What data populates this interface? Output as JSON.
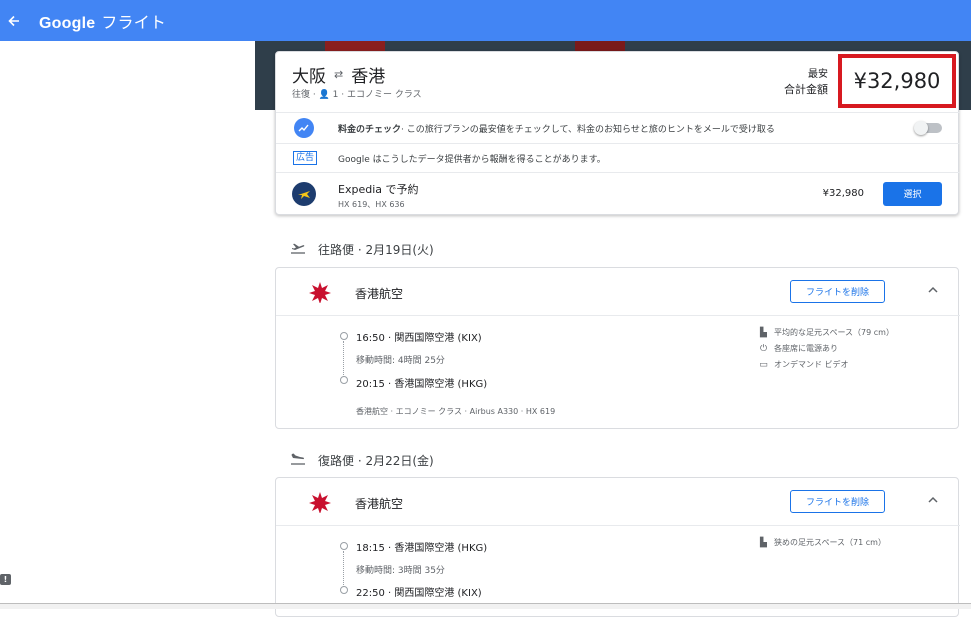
{
  "header": {
    "back_icon": "arrow-left-icon",
    "brand_google": "Google",
    "brand_flights": "フライト",
    "color": "#4285f4"
  },
  "summary": {
    "from": "大阪",
    "to": "香港",
    "swap_icon": "swap-arrows-icon",
    "trip_info": "往復 · 👤 1 · エコノミー クラス",
    "price_label_line1": "最安",
    "price_label_line2": "合計金額",
    "price": "¥32,980",
    "highlight_color": "#d71920",
    "price_tracking_title": "料金のチェック",
    "price_tracking_text": "· この旅行プランの最安値をチェックして、料金のお知らせと旅のヒントをメールで受け取る",
    "price_tracking_on": false,
    "ad_tag": "広告",
    "ad_text": "Google はこうしたデータ提供者から報酬を得ることがあります。",
    "provider_title": "Expedia で予約",
    "provider_flights": "HX 619、HX 636",
    "provider_price": "¥32,980",
    "select_label": "選択"
  },
  "outbound": {
    "heading": "往路便 · 2月19日(火)",
    "airline": "香港航空",
    "remove_label": "フライトを削除",
    "depart": "16:50 · 関西国際空港 (KIX)",
    "duration": "移動時間: 4時間 25分",
    "arrive": "20:15 · 香港国際空港 (HKG)",
    "details": "香港航空 · エコノミー クラス · Airbus A330 · HX 619",
    "amenities": [
      "平均的な足元スペース（79 cm）",
      "各座席に電源あり",
      "オンデマンド ビデオ"
    ]
  },
  "return": {
    "heading": "復路便 · 2月22日(金)",
    "airline": "香港航空",
    "remove_label": "フライトを削除",
    "depart": "18:15 · 香港国際空港 (HKG)",
    "duration": "移動時間: 3時間 35分",
    "arrive": "22:50 · 関西国際空港 (KIX)",
    "amenities": [
      "狭めの足元スペース（71 cm）"
    ]
  }
}
